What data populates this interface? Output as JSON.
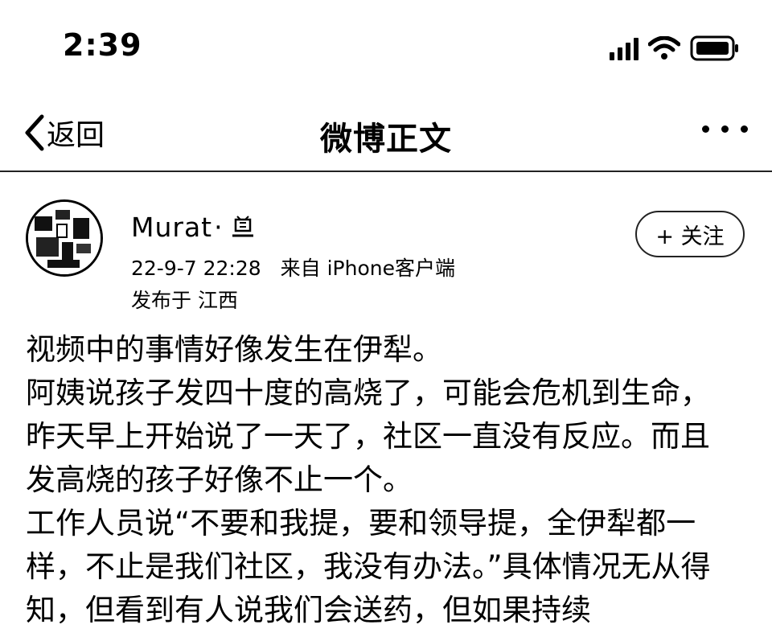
{
  "status_bar": {
    "time": "2:39",
    "icons": [
      "cellular-signal-icon",
      "wifi-icon",
      "battery-icon"
    ]
  },
  "nav": {
    "back_label": "返回",
    "title": "微博正文",
    "more_icon": "more-dots-icon"
  },
  "post": {
    "author": "Murat",
    "author_separator": "·",
    "time": "22-9-7 22:28",
    "source": "来自 iPhone客户端",
    "location": "发布于 江西",
    "follow_label": "+ 关注",
    "lines": [
      "视频中的事情好像发生在伊犁。",
      "阿姨说孩子发四十度的高烧了，可能会危机到生命，",
      "昨天早上开始说了一天了，社区一直没有反应。而且",
      "发高烧的孩子好像不止一个。",
      "工作人员说“不要和我提，要和领导提，全伊犁都一",
      "样，不止是我们社区，我没有办法。”具体情况无从得",
      "知，但看到有人说我们会送药，但如果持续"
    ]
  }
}
